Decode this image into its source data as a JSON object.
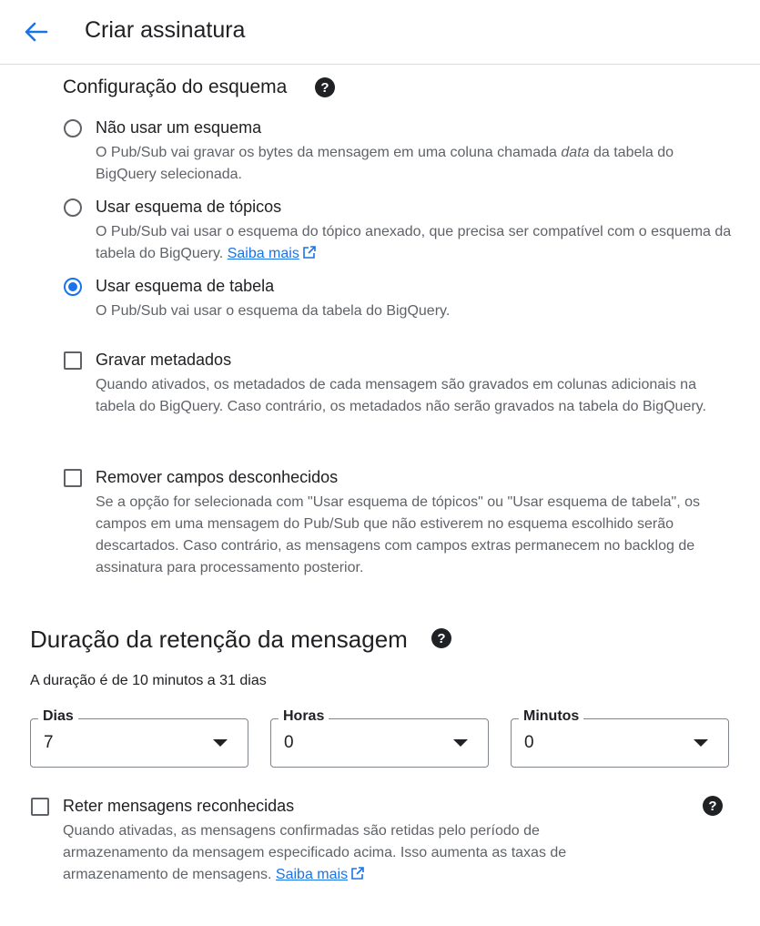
{
  "header": {
    "title": "Criar assinatura"
  },
  "schema_section": {
    "title": "Configuração do esquema",
    "options": [
      {
        "label": "Não usar um esquema",
        "desc_before": "O Pub/Sub vai gravar os bytes da mensagem em uma coluna chamada ",
        "desc_em": "data",
        "desc_after": " da tabela do BigQuery selecionada.",
        "selected": false
      },
      {
        "label": "Usar esquema de tópicos",
        "desc": "O Pub/Sub vai usar o esquema do tópico anexado, que precisa ser compatível com o esquema da tabela do BigQuery.",
        "link": "Saiba mais",
        "selected": false
      },
      {
        "label": "Usar esquema de tabela",
        "desc": "O Pub/Sub vai usar o esquema da tabela do BigQuery.",
        "selected": true
      }
    ],
    "checkboxes": [
      {
        "label": "Gravar metadados",
        "desc": "Quando ativados, os metadados de cada mensagem são gravados em colunas adicionais na tabela do BigQuery. Caso contrário, os metadados não serão gravados na tabela do BigQuery.",
        "checked": false
      },
      {
        "label": "Remover campos desconhecidos",
        "desc": "Se a opção for selecionada com \"Usar esquema de tópicos\" ou \"Usar esquema de tabela\", os campos em uma mensagem do Pub/Sub que não estiverem no esquema escolhido serão descartados. Caso contrário, as mensagens com campos extras permanecem no backlog de assinatura para processamento posterior.",
        "checked": false
      }
    ]
  },
  "retention_section": {
    "title": "Duração da retenção da mensagem",
    "info": "A duração é de 10 minutos a 31 dias",
    "fields": [
      {
        "label": "Dias",
        "value": "7"
      },
      {
        "label": "Horas",
        "value": "0"
      },
      {
        "label": "Minutos",
        "value": "0"
      }
    ],
    "retain": {
      "label": "Reter mensagens reconhecidas",
      "desc": "Quando ativadas, as mensagens confirmadas são retidas pelo período de armazenamento da mensagem especificado acima. Isso aumenta as taxas de armazenamento de mensagens.",
      "link": "Saiba mais",
      "checked": false
    }
  },
  "colors": {
    "accent": "#1a73e8",
    "text": "#202124",
    "secondary": "#5f6368",
    "border": "#dadce0"
  },
  "icons": [
    "arrow-back-icon",
    "help-icon",
    "open-in-new-icon",
    "dropdown-caret-icon"
  ]
}
